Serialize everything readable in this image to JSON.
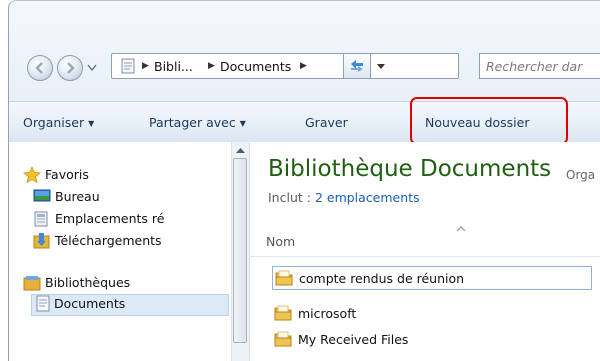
{
  "address": {
    "crumbs": [
      "Bibli...",
      "Documents"
    ],
    "search_placeholder": "Rechercher dar"
  },
  "toolbar": {
    "organize": "Organiser",
    "share": "Partager avec",
    "burn": "Graver",
    "new_folder": "Nouveau dossier"
  },
  "sidebar": {
    "favorites": "Favoris",
    "desktop": "Bureau",
    "recent_places": "Emplacements ré",
    "downloads": "Téléchargements",
    "libraries": "Bibliothèques",
    "documents": "Documents"
  },
  "main": {
    "title": "Bibliothèque Documents",
    "arrange": "Orga",
    "includes_prefix": "Inclut :",
    "includes_link": "2 emplacements",
    "column_name": "Nom",
    "files": [
      "compte rendus de réunion",
      "microsoft",
      "My Received Files"
    ]
  }
}
